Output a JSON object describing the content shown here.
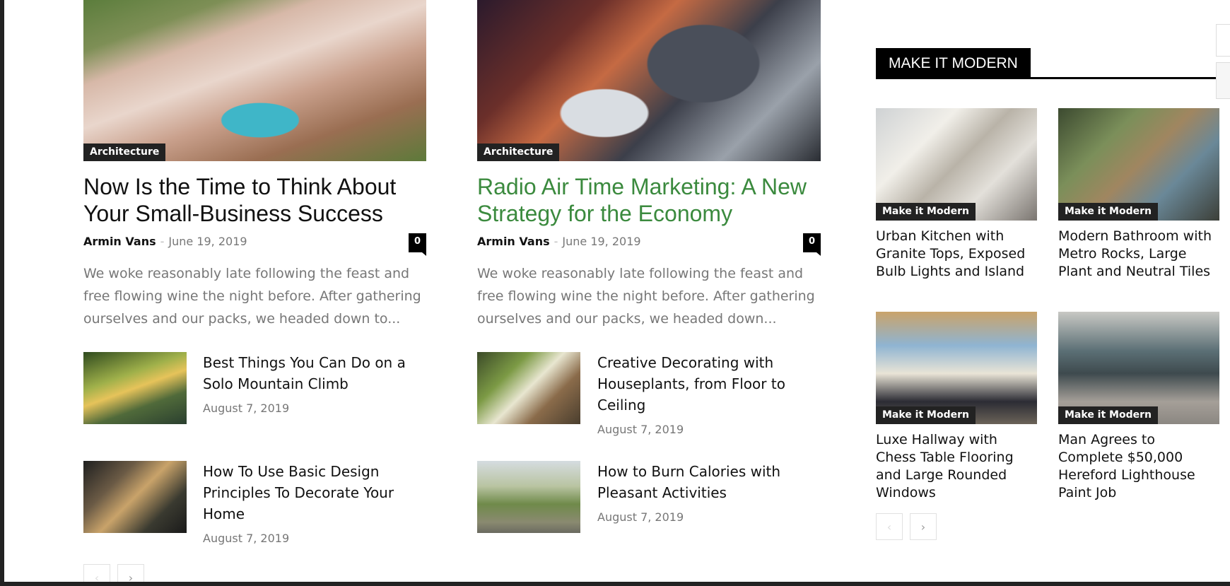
{
  "featured": [
    {
      "category": "Architecture",
      "title": "Now Is the Time to Think About Your Small-Business Success",
      "author": "Armin Vans",
      "separator": "-",
      "date": "June 19, 2019",
      "comments": "0",
      "excerpt": "We woke reasonably late following the feast and free flowing wine the night before. After gathering ourselves and our packs, we headed down to..."
    },
    {
      "category": "Architecture",
      "title": "Radio Air Time Marketing: A New Strategy for the Economy",
      "author": "Armin Vans",
      "separator": "-",
      "date": "June 19, 2019",
      "comments": "0",
      "excerpt": "We woke reasonably late following the feast and free flowing wine the night before. After gathering ourselves and our packs, we headed down..."
    }
  ],
  "list_left": [
    {
      "title": "Best Things You Can Do on a Solo Mountain Climb",
      "date": "August 7, 2019"
    },
    {
      "title": "How To Use Basic Design Principles To Decorate Your Home",
      "date": "August 7, 2019"
    }
  ],
  "list_right": [
    {
      "title": "Creative Decorating with Houseplants, from Floor to Ceiling",
      "date": "August 7, 2019"
    },
    {
      "title": "How to Burn Calories with Pleasant Activities",
      "date": "August 7, 2019"
    }
  ],
  "sidebar": {
    "block_title": "MAKE IT MODERN",
    "posts": [
      {
        "category": "Make it Modern",
        "title": "Urban Kitchen with Granite Tops, Exposed Bulb Lights and Island"
      },
      {
        "category": "Make it Modern",
        "title": "Modern Bathroom with Metro Rocks, Large Plant and Neutral Tiles"
      },
      {
        "category": "Make it Modern",
        "title": "Luxe Hallway with Chess Table Flooring and Large Rounded Windows"
      },
      {
        "category": "Make it Modern",
        "title": "Man Agrees to Complete $50,000 Hereford Lighthouse Paint Job"
      }
    ]
  },
  "icons": {
    "prev": "‹",
    "next": "›"
  }
}
